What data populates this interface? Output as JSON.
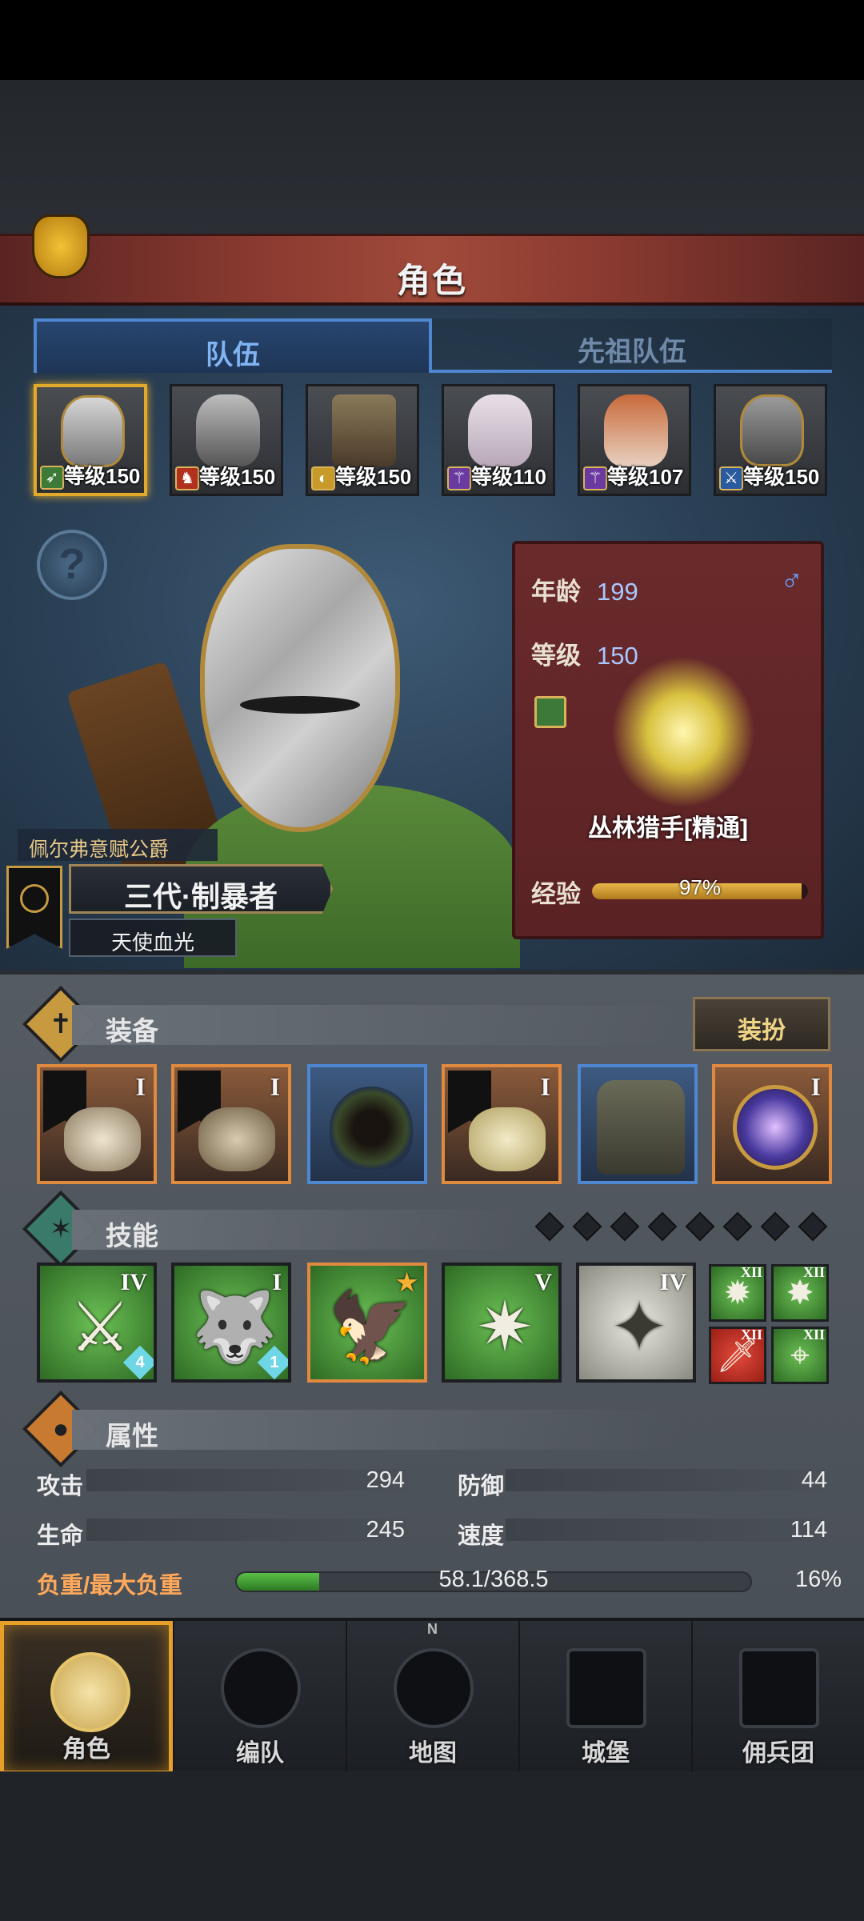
{
  "header": {
    "title": "角色"
  },
  "tabs": [
    {
      "label": "队伍",
      "active": true
    },
    {
      "label": "先祖队伍",
      "active": false
    }
  ],
  "roster": [
    {
      "level_text": "等级150",
      "class_icon": "bow-class-icon",
      "selected": true
    },
    {
      "level_text": "等级150",
      "class_icon": "horse-class-icon",
      "selected": false
    },
    {
      "level_text": "等级150",
      "class_icon": "shield-class-icon",
      "selected": false
    },
    {
      "level_text": "等级110",
      "class_icon": "staff-class-icon",
      "selected": false
    },
    {
      "level_text": "等级107",
      "class_icon": "staff-class-icon",
      "selected": false
    },
    {
      "level_text": "等级150",
      "class_icon": "sword-class-icon",
      "selected": false
    }
  ],
  "hero": {
    "house_title": "佩尔弗意赋公爵",
    "name": "三代·制暴者",
    "subtitle": "天使血光"
  },
  "info_card": {
    "age_label": "年龄",
    "age": "199",
    "level_label": "等级",
    "level": "150",
    "gender_symbol": "♂",
    "class_name": "丛林猎手[精通]",
    "exp_label": "经验",
    "exp_text": "97%",
    "exp_value": 0.97
  },
  "equipment": {
    "title": "装备",
    "dress_button": "装扮",
    "slots": [
      {
        "rank": "I",
        "frame": "orange",
        "icon": "bow-item-icon"
      },
      {
        "rank": "I",
        "frame": "orange",
        "icon": "bow-item-icon"
      },
      {
        "rank": "",
        "frame": "blue",
        "icon": "hood-item-icon"
      },
      {
        "rank": "I",
        "frame": "orange",
        "icon": "armor-item-icon"
      },
      {
        "rank": "",
        "frame": "blue",
        "icon": "boots-item-icon"
      },
      {
        "rank": "I",
        "frame": "orange",
        "icon": "orb-item-icon"
      }
    ]
  },
  "skills": {
    "title": "技能",
    "pip_count": 8,
    "list": [
      {
        "rank": "IV",
        "glyph": "⚔",
        "badge": "4",
        "frame": "dark",
        "icon": "sword-spirit-skill-icon"
      },
      {
        "rank": "I",
        "glyph": "🐺",
        "badge": "1",
        "frame": "dark",
        "icon": "wolf-skill-icon"
      },
      {
        "rank": "★",
        "glyph": "🦅",
        "badge": "",
        "frame": "orange",
        "icon": "eagle-skill-icon"
      },
      {
        "rank": "V",
        "glyph": "✷",
        "badge": "",
        "frame": "dark",
        "icon": "crystal-burst-skill-icon"
      },
      {
        "rank": "IV",
        "glyph": "✦",
        "badge": "",
        "frame": "dark",
        "icon": "crystal-hand-skill-icon"
      }
    ],
    "passives": [
      {
        "rank": "XII",
        "glyph": "✹",
        "color": "green",
        "icon": "burst-passive-icon"
      },
      {
        "rank": "XII",
        "glyph": "✸",
        "color": "green",
        "icon": "spark-passive-icon"
      },
      {
        "rank": "XII",
        "glyph": "🗡",
        "color": "red",
        "icon": "dagger-passive-icon"
      },
      {
        "rank": "XII",
        "glyph": "⌖",
        "color": "green",
        "icon": "target-passive-icon"
      }
    ]
  },
  "attributes": {
    "title": "属性",
    "attack_label": "攻击",
    "attack": "294",
    "defense_label": "防御",
    "defense": "44",
    "hp_label": "生命",
    "hp": "245",
    "speed_label": "速度",
    "speed": "114",
    "load_label": "负重/最大负重",
    "load_text": "58.1/368.5",
    "load_pct_text": "16%",
    "load_fraction": 0.16
  },
  "nav": [
    {
      "label": "角色",
      "active": true,
      "icon": "knight-icon"
    },
    {
      "label": "编队",
      "active": false,
      "icon": "formation-icon"
    },
    {
      "label": "地图",
      "active": false,
      "icon": "compass-map-icon"
    },
    {
      "label": "城堡",
      "active": false,
      "icon": "castle-icon"
    },
    {
      "label": "佣兵团",
      "active": false,
      "icon": "mercenary-icon"
    }
  ],
  "compass_letter": "N",
  "colors": {
    "accent_gold": "#e6a02a",
    "tab_blue": "#4f86d0",
    "title_red": "#8a3a30",
    "load_green": "#5ac048",
    "load_label": "#ffa85a"
  }
}
